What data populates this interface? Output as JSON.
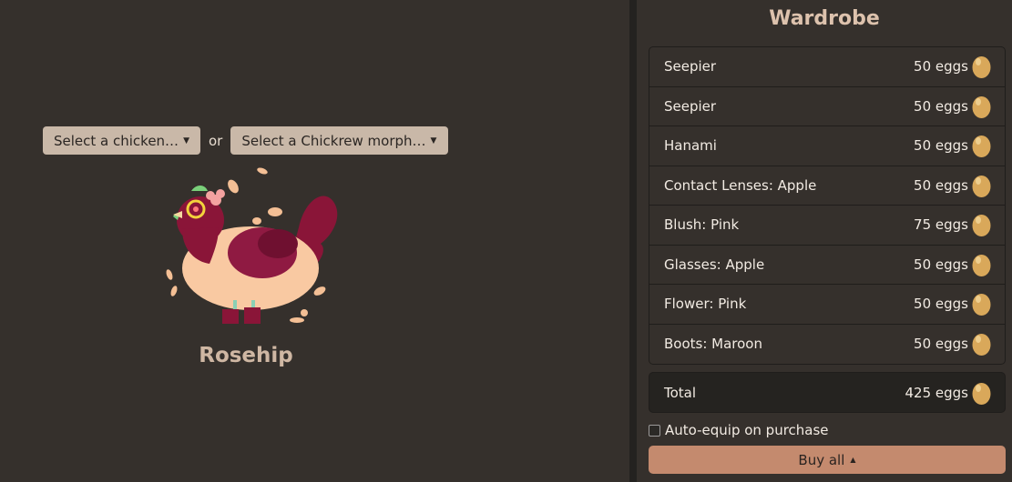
{
  "left": {
    "select_chicken": "Select a chicken…",
    "or": "or",
    "select_morph": "Select a Chickrew morph…",
    "chicken_name": "Rosehip"
  },
  "wardrobe": {
    "title": "Wardrobe",
    "items": [
      {
        "name": "Seepier",
        "price": "50 eggs"
      },
      {
        "name": "Seepier",
        "price": "50 eggs"
      },
      {
        "name": "Hanami",
        "price": "50 eggs"
      },
      {
        "name": "Contact Lenses: Apple",
        "price": "50 eggs"
      },
      {
        "name": "Blush: Pink",
        "price": "75 eggs"
      },
      {
        "name": "Glasses: Apple",
        "price": "50 eggs"
      },
      {
        "name": "Flower: Pink",
        "price": "50 eggs"
      },
      {
        "name": "Boots: Maroon",
        "price": "50 eggs"
      }
    ],
    "total_label": "Total",
    "total_price": "425 eggs",
    "auto_equip_label": "Auto-equip on purchase",
    "auto_equip_checked": false,
    "buy_all_label": "Buy all"
  },
  "icons": {
    "caret": "triangle-down",
    "egg": "golden-egg-icon"
  },
  "colors": {
    "background": "#35302c",
    "accent_button": "#c48a6e",
    "select_button": "#c9b8a8",
    "title": "#ddc2ad"
  }
}
